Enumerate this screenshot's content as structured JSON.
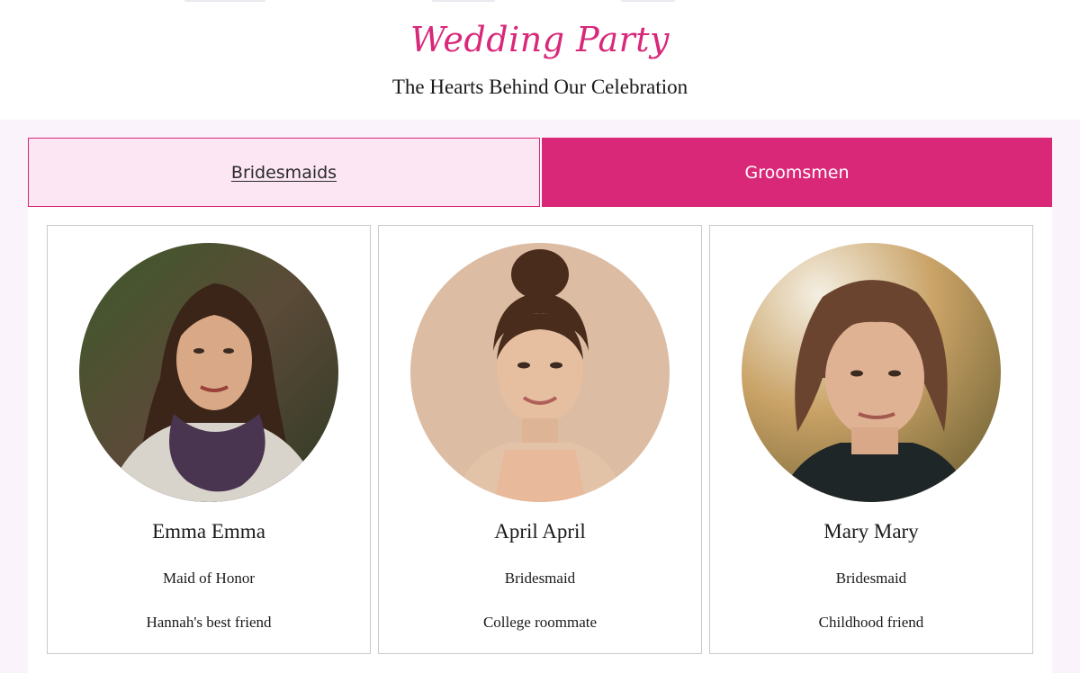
{
  "header": {
    "title": "Wedding Party",
    "subtitle": "The Hearts Behind Our Celebration"
  },
  "tabs": [
    {
      "label": "Bridesmaids",
      "active": true
    },
    {
      "label": "Groomsmen",
      "active": false
    }
  ],
  "members": [
    {
      "name": "Emma Emma",
      "role": "Maid of Honor",
      "relation": "Hannah's best friend",
      "photo": "woman-dark-hair-scarf-photo"
    },
    {
      "name": "April April",
      "role": "Bridesmaid",
      "relation": "College roommate",
      "photo": "woman-hair-bun-photo"
    },
    {
      "name": "Mary Mary",
      "role": "Bridesmaid",
      "relation": "Childhood friend",
      "photo": "woman-bob-haircut-photo"
    }
  ],
  "colors": {
    "accent": "#d8287a",
    "tab_active_bg": "#fce6f4",
    "tab_inactive_bg": "#da2879",
    "section_bg": "#fbf3fb"
  }
}
